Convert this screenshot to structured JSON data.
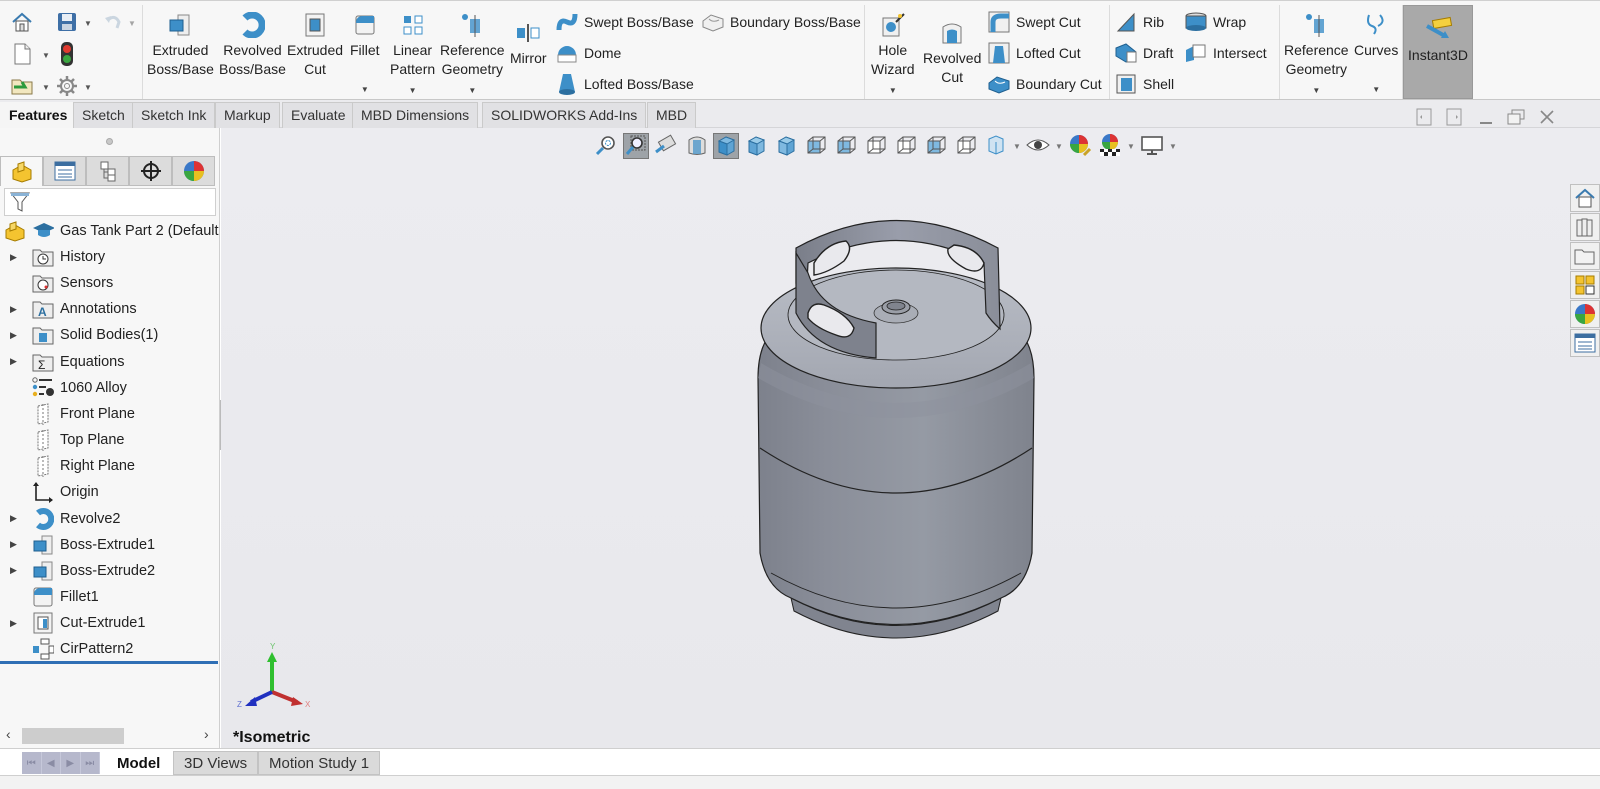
{
  "quick_access": {
    "items": [
      {
        "name": "home",
        "icon": "home-icon"
      },
      {
        "name": "save",
        "icon": "save-icon",
        "has_dropdown": true
      },
      {
        "name": "undo",
        "icon": "undo-icon",
        "has_dropdown": true,
        "disabled": true
      },
      {
        "name": "new",
        "icon": "new-document-icon",
        "has_dropdown": true
      },
      {
        "name": "rebuild",
        "icon": "traffic-light-icon"
      },
      {
        "name": "open",
        "icon": "open-folder-icon",
        "has_dropdown": true
      },
      {
        "name": "options",
        "icon": "gear-icon",
        "has_dropdown": true
      }
    ]
  },
  "ribbon": {
    "extruded_boss": {
      "line1": "Extruded",
      "line2": "Boss/Base"
    },
    "revolved_boss": {
      "line1": "Revolved",
      "line2": "Boss/Base"
    },
    "extruded_cut": {
      "line1": "Extruded",
      "line2": "Cut"
    },
    "fillet": {
      "line1": "Fillet"
    },
    "linear_pattern": {
      "line1": "Linear",
      "line2": "Pattern"
    },
    "reference_geometry": {
      "line1": "Reference",
      "line2": "Geometry"
    },
    "mirror": {
      "line1": "Mirror"
    },
    "swept_boss": "Swept Boss/Base",
    "dome": "Dome",
    "lofted_boss": "Lofted Boss/Base",
    "boundary_boss": "Boundary Boss/Base",
    "hole_wizard": {
      "line1": "Hole",
      "line2": "Wizard"
    },
    "revolved_cut": {
      "line1": "Revolved",
      "line2": "Cut"
    },
    "swept_cut": "Swept Cut",
    "lofted_cut": "Lofted Cut",
    "boundary_cut": "Boundary Cut",
    "rib": "Rib",
    "draft": "Draft",
    "shell": "Shell",
    "wrap": "Wrap",
    "intersect": "Intersect",
    "reference_geometry_2": {
      "line1": "Reference",
      "line2": "Geometry"
    },
    "curves": {
      "line1": "Curves"
    },
    "instant3d": {
      "line1": "Instant3D",
      "active": true
    }
  },
  "command_tabs": [
    {
      "label": "Features",
      "active": true
    },
    {
      "label": "Sketch"
    },
    {
      "label": "Sketch Ink"
    },
    {
      "label": "Markup"
    },
    {
      "label": "Evaluate"
    },
    {
      "label": "MBD Dimensions"
    },
    {
      "label": "SOLIDWORKS Add-Ins"
    },
    {
      "label": "MBD"
    }
  ],
  "window_controls": [
    "tile-left-icon",
    "tile-right-icon",
    "minimize-icon",
    "restore-icon",
    "close-icon"
  ],
  "panel_tabs": [
    {
      "name": "feature-manager",
      "icon": "part-icon",
      "active": true
    },
    {
      "name": "property-manager",
      "icon": "property-list-icon"
    },
    {
      "name": "configuration-manager",
      "icon": "configuration-icon"
    },
    {
      "name": "dimxpert-manager",
      "icon": "crosshair-icon"
    },
    {
      "name": "display-manager",
      "icon": "appearance-sphere-icon"
    }
  ],
  "feature_tree": {
    "root": "Gas Tank Part 2  (Default",
    "items": [
      {
        "label": "History",
        "icon": "history-folder-icon",
        "expandable": true
      },
      {
        "label": "Sensors",
        "icon": "sensors-folder-icon",
        "expandable": false
      },
      {
        "label": "Annotations",
        "icon": "annotations-folder-icon",
        "expandable": true
      },
      {
        "label": "Solid Bodies(1)",
        "icon": "solid-bodies-folder-icon",
        "expandable": true
      },
      {
        "label": "Equations",
        "icon": "equations-folder-icon",
        "expandable": true
      },
      {
        "label": "1060 Alloy",
        "icon": "material-icon",
        "expandable": false
      },
      {
        "label": "Front Plane",
        "icon": "plane-icon",
        "expandable": false
      },
      {
        "label": "Top Plane",
        "icon": "plane-icon",
        "expandable": false
      },
      {
        "label": "Right Plane",
        "icon": "plane-icon",
        "expandable": false
      },
      {
        "label": "Origin",
        "icon": "origin-icon",
        "expandable": false
      },
      {
        "label": "Revolve2",
        "icon": "revolve-icon",
        "expandable": true
      },
      {
        "label": "Boss-Extrude1",
        "icon": "extrude-icon",
        "expandable": true
      },
      {
        "label": "Boss-Extrude2",
        "icon": "extrude-icon",
        "expandable": true
      },
      {
        "label": "Fillet1",
        "icon": "fillet-icon",
        "expandable": false
      },
      {
        "label": "Cut-Extrude1",
        "icon": "cut-extrude-icon",
        "expandable": true
      },
      {
        "label": "CirPattern2",
        "icon": "circular-pattern-icon",
        "expandable": false
      }
    ]
  },
  "viewport": {
    "view_name": "*Isometric",
    "triad": {
      "x": "X",
      "y": "Y",
      "z": "Z"
    },
    "heads_up_toolbar": [
      "zoom-to-fit-icon",
      "zoom-to-area-icon",
      "previous-view-icon",
      "section-view-icon",
      "isometric-view-icon",
      "front-view-icon",
      "back-view-icon",
      "left-view-icon",
      "right-view-icon",
      "top-view-icon",
      "bottom-view-icon",
      "trimetric-view-icon",
      "dimetric-view-icon",
      "display-style-icon",
      "hide-show-icon",
      "edit-appearance-icon",
      "apply-scene-icon",
      "view-settings-icon"
    ],
    "model": "Gas tank (propane cylinder) with handle collar and valve neck",
    "colors": {
      "background": "#ebebef",
      "model": "#8a8e99",
      "active_tool": "#9ea3a8"
    }
  },
  "task_pane": [
    "solidworks-resources-icon",
    "design-library-icon",
    "file-explorer-icon",
    "view-palette-icon",
    "appearances-icon",
    "custom-properties-icon"
  ],
  "bottom_tabs": [
    {
      "label": "Model",
      "active": true
    },
    {
      "label": "3D Views"
    },
    {
      "label": "Motion Study 1"
    }
  ],
  "colors": {
    "accent": "#2f6fb5",
    "icon_blue": "#3d8fc8",
    "instant3d_bg": "#a9a9a9"
  }
}
